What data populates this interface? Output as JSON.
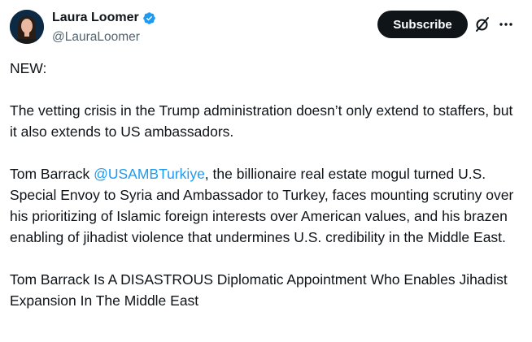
{
  "author": {
    "display_name": "Laura Loomer",
    "handle": "@LauraLoomer",
    "verified_color": "#1d9bf0"
  },
  "header": {
    "subscribe_label": "Subscribe",
    "grok_icon": "grok-icon",
    "more_icon": "more-icon"
  },
  "tweet": {
    "p1": "NEW:",
    "p2": "The vetting crisis in the Trump administration doesn’t only extend to staffers, but it also extends to US ambassadors.",
    "p3_before": "Tom Barrack ",
    "p3_mention": "@USAMBTurkiye",
    "p3_after": ", the billionaire real estate mogul turned U.S. Special Envoy to Syria and Ambassador to Turkey, faces mounting scrutiny over his prioritizing of Islamic foreign interests over American values, and his brazen enabling of jihadist violence that undermines U.S. credibility in the Middle East.",
    "p4": "Tom Barrack Is A DISASTROUS Diplomatic Appointment Who Enables Jihadist Expansion In The Middle East"
  },
  "colors": {
    "text": "#0f1419",
    "secondary": "#536471",
    "link": "#1d9bf0",
    "button_bg": "#0f1419"
  }
}
